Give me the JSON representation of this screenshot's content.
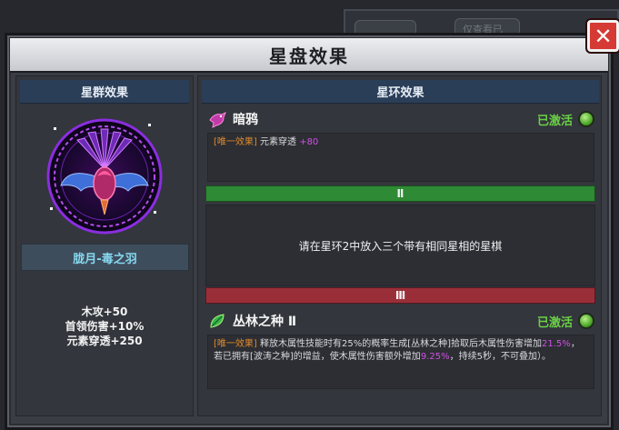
{
  "modal": {
    "title": "星盘效果",
    "close_label": "✕"
  },
  "background": {
    "pill_left": "",
    "pill_right": "仅查看已"
  },
  "left_panel": {
    "header": "星群效果",
    "constellation_name": "胧月-毒之羽",
    "stats": [
      "木攻+50",
      "首领伤害+10%",
      "元素穿透+250"
    ]
  },
  "right_panel": {
    "header": "星环效果",
    "entries": [
      {
        "name": "暗鸦",
        "status": "已激活",
        "icon": "crow-icon",
        "effect_tag": "[唯一效果]",
        "effect_text": "元素穿透",
        "effect_value": "+80"
      },
      {
        "name": "丛林之种 Ⅱ",
        "status": "已激活",
        "icon": "leaf-seed-icon",
        "effect_tag": "[唯一效果]",
        "effect_part1": "释放木属性技能时有25%的概率生成[丛林之种]拾取后木属性伤害增加",
        "effect_val1": "21.5%",
        "effect_part2": "，若已拥有[波涛之种]的增益，使木属性伤害额外增加",
        "effect_val2": "9.25%",
        "effect_part3": "，持续5秒，不可叠加）。"
      }
    ],
    "band_2": "Ⅱ",
    "band_3": "Ⅲ",
    "ring2_requirement": "请在星环2中放入三个带有相同星相的星棋"
  },
  "colors": {
    "active_green": "#6ad046",
    "band_green": "#2e8a34",
    "band_red": "#9a2e38",
    "highlight_purple": "#d050e6",
    "tag_orange": "#e08a2c",
    "name_cyan": "#86d8f0"
  }
}
